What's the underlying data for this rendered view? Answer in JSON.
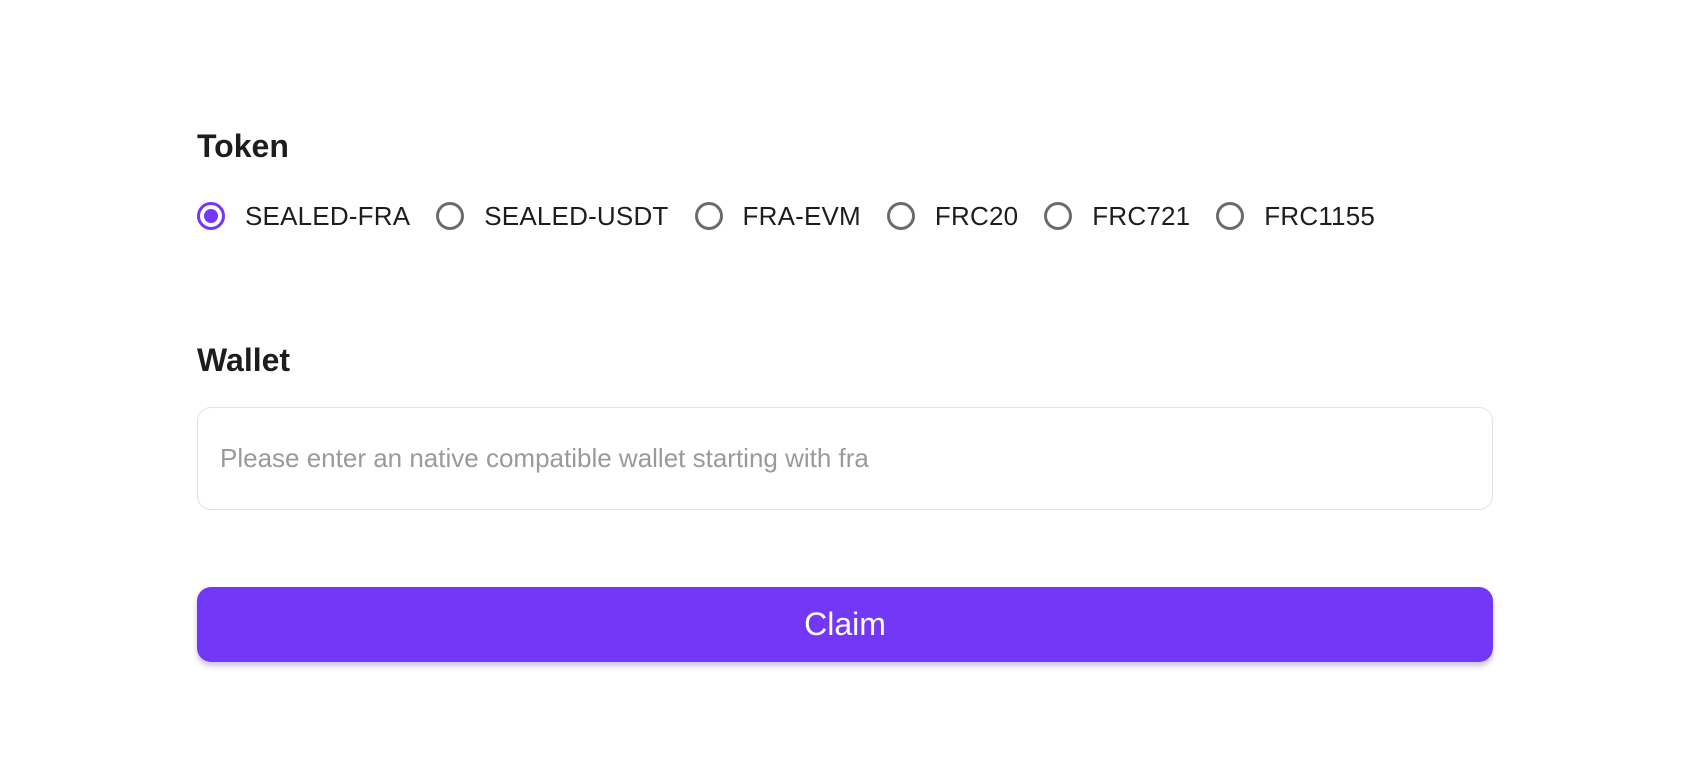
{
  "token": {
    "title": "Token",
    "options": [
      {
        "label": "SEALED-FRA",
        "checked": true
      },
      {
        "label": "SEALED-USDT",
        "checked": false
      },
      {
        "label": "FRA-EVM",
        "checked": false
      },
      {
        "label": "FRC20",
        "checked": false
      },
      {
        "label": "FRC721",
        "checked": false
      },
      {
        "label": "FRC1155",
        "checked": false
      }
    ]
  },
  "wallet": {
    "title": "Wallet",
    "value": "",
    "placeholder": "Please enter an native compatible wallet starting with fra"
  },
  "claim": {
    "label": "Claim"
  },
  "colors": {
    "accent": "#7237f7",
    "radio_unchecked": "#6b6b6b",
    "input_border": "#e2e2e6",
    "placeholder": "#9a9a9e",
    "text": "#1d1d1f"
  }
}
